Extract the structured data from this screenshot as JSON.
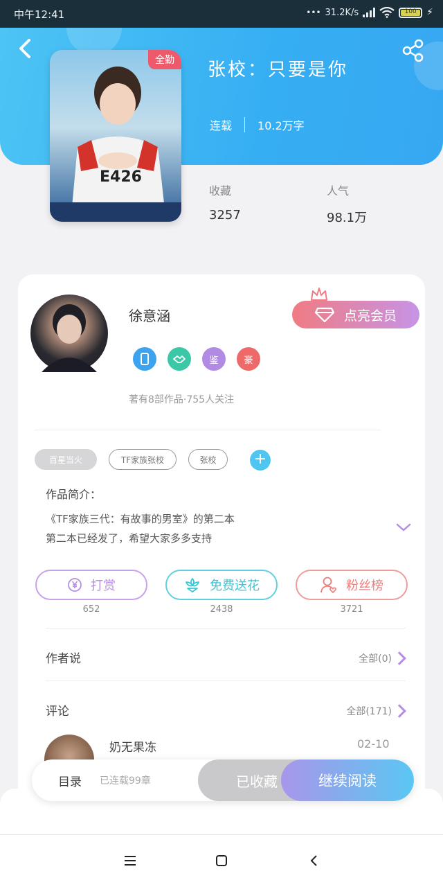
{
  "status_bar": {
    "time": "中午12:41",
    "speed": "31.2K/s",
    "battery": "100"
  },
  "book": {
    "cover_badge": "全勤",
    "title": "张校：只要是你",
    "status": "连载",
    "word_count": "10.2万字",
    "stats": [
      {
        "label": "收藏",
        "value": "3257"
      },
      {
        "label": "人气",
        "value": "98.1万"
      }
    ]
  },
  "author": {
    "name": "徐意涵",
    "member_button": "点亮会员",
    "badges": [
      "",
      "",
      "鉴",
      "豪"
    ],
    "subtitle": "著有8部作品·755人关注"
  },
  "tags": [
    "百星当火",
    "TF家族张校",
    "张校"
  ],
  "intro": {
    "label": "作品简介：",
    "lines": [
      "《TF家族三代：有故事的男室》的第二本",
      "第二本已经发了，希望大家多多支持"
    ]
  },
  "actions": [
    {
      "label": "打赏",
      "count": "652"
    },
    {
      "label": "免费送花",
      "count": "2438"
    },
    {
      "label": "粉丝榜",
      "count": "3721"
    }
  ],
  "author_says": {
    "title": "作者说",
    "link": "全部(0)"
  },
  "comments": {
    "title": "评论",
    "link": "全部(171)",
    "first_name": "奶无果冻",
    "first_date": "02-10"
  },
  "bottom": {
    "catalog": "目录",
    "serial": "已连载99章",
    "collected": "已收藏",
    "continue_reading": "继续阅读"
  },
  "colors": {
    "header": "#36aef3",
    "accent_purple": "#b58de2",
    "accent_teal": "#38c7d6",
    "accent_red": "#ee7d7d"
  },
  "icons": [
    "back-icon",
    "share-icon",
    "diamond-icon",
    "crown-icon",
    "yen-icon",
    "flower-icon",
    "user-heart-icon",
    "plus-icon",
    "chevron-down-icon",
    "chevron-right-icon",
    "menu-icon",
    "home-square-icon",
    "back-triangle-icon"
  ]
}
